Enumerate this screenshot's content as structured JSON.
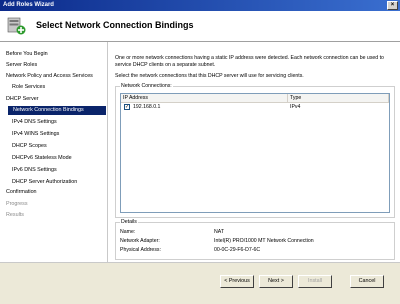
{
  "window": {
    "title": "Add Roles Wizard"
  },
  "header": {
    "title": "Select Network Connection Bindings"
  },
  "sidebar": {
    "items": [
      {
        "label": "Before You Begin"
      },
      {
        "label": "Server Roles"
      },
      {
        "label": "Network Policy and Access Services"
      },
      {
        "label": "Role Services"
      },
      {
        "label": "DHCP Server"
      },
      {
        "label": "Network Connection Bindings"
      },
      {
        "label": "IPv4 DNS Settings"
      },
      {
        "label": "IPv4 WINS Settings"
      },
      {
        "label": "DHCP Scopes"
      },
      {
        "label": "DHCPv6 Stateless Mode"
      },
      {
        "label": "IPv6 DNS Settings"
      },
      {
        "label": "DHCP Server Authorization"
      },
      {
        "label": "Confirmation"
      },
      {
        "label": "Progress"
      },
      {
        "label": "Results"
      }
    ]
  },
  "main": {
    "intro": "One or more network connections having a static IP address were detected. Each network connection can be used to service DHCP clients on a separate subnet.",
    "instruction": "Select the network connections that this DHCP server will use for servicing clients.",
    "connections_label": "Network Connections:",
    "columns": [
      "IP Address",
      "Type"
    ],
    "rows": [
      {
        "ip": "192.168.0.1",
        "type": "IPv4",
        "checked": true
      }
    ]
  },
  "details": {
    "label": "Details",
    "name_label": "Name:",
    "name_value": "NAT",
    "adapter_label": "Network Adapter:",
    "adapter_value": "Intel(R) PRO/1000 MT Network Connection",
    "physical_label": "Physical Address:",
    "physical_value": "00-0C-29-F6-D7-6C"
  },
  "footer": {
    "previous": "< Previous",
    "next": "Next >",
    "install": "Install",
    "cancel": "Cancel"
  }
}
